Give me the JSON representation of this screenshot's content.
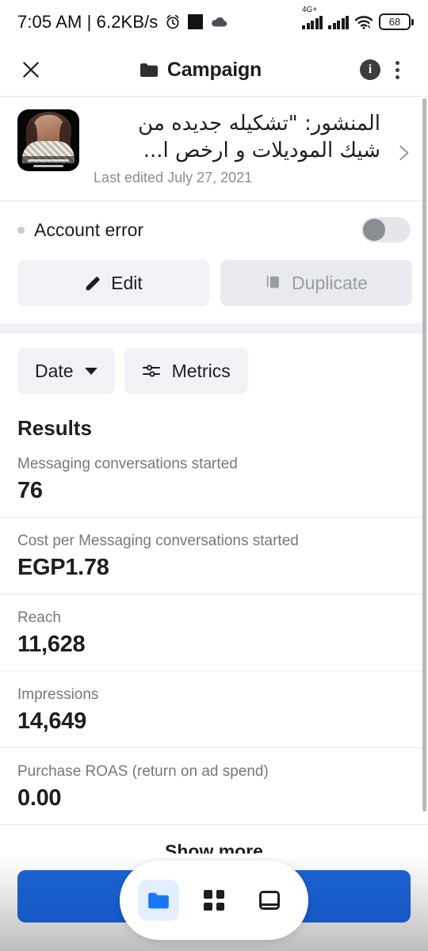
{
  "status_bar": {
    "clock": "7:05 AM | 6.2KB/s",
    "alarm_icon": "alarm-clock-icon",
    "square_icon": "black-square-icon",
    "cloud_icon": "cloud-icon",
    "network_label": "4G+",
    "wifi_icon": "wifi-icon",
    "battery_level": "68"
  },
  "header": {
    "close_icon": "close-icon",
    "folder_icon": "folder-icon",
    "title": "Campaign",
    "info_icon": "i",
    "menu_icon": "more-vertical-icon"
  },
  "post": {
    "thumbnail_alt": "campaign-creative-thumbnail",
    "title": "المنشور: \"تشكيله جديده من شيك الموديلات و ارخص ا...",
    "last_edited": "Last edited July 27, 2021",
    "chevron_icon": "chevron-right-icon"
  },
  "status_section": {
    "dot_color": "#c9ccd1",
    "label": "Account error",
    "toggle_state": "off"
  },
  "actions": {
    "edit_label": "Edit",
    "edit_icon": "pencil-icon",
    "duplicate_label": "Duplicate",
    "duplicate_icon": "copy-icon",
    "duplicate_disabled": true
  },
  "filters": {
    "date_label": "Date",
    "date_caret_icon": "chevron-down-icon",
    "metrics_label": "Metrics",
    "metrics_icon": "tune-sliders-icon"
  },
  "results": {
    "title": "Results",
    "metrics": [
      {
        "label": "Messaging conversations started",
        "value": "76"
      },
      {
        "label": "Cost per Messaging conversations started",
        "value": "EGP1.78"
      },
      {
        "label": "Reach",
        "value": "11,628"
      },
      {
        "label": "Impressions",
        "value": "14,649"
      },
      {
        "label": "Purchase ROAS (return on ad spend)",
        "value": "0.00"
      }
    ],
    "show_more_label": "Show more"
  },
  "bottom_nav": {
    "bar_color": "#1559c4",
    "items": [
      {
        "icon": "folder-icon",
        "active": true
      },
      {
        "icon": "grid-apps-icon",
        "active": false
      },
      {
        "icon": "card-window-icon",
        "active": false
      }
    ]
  }
}
